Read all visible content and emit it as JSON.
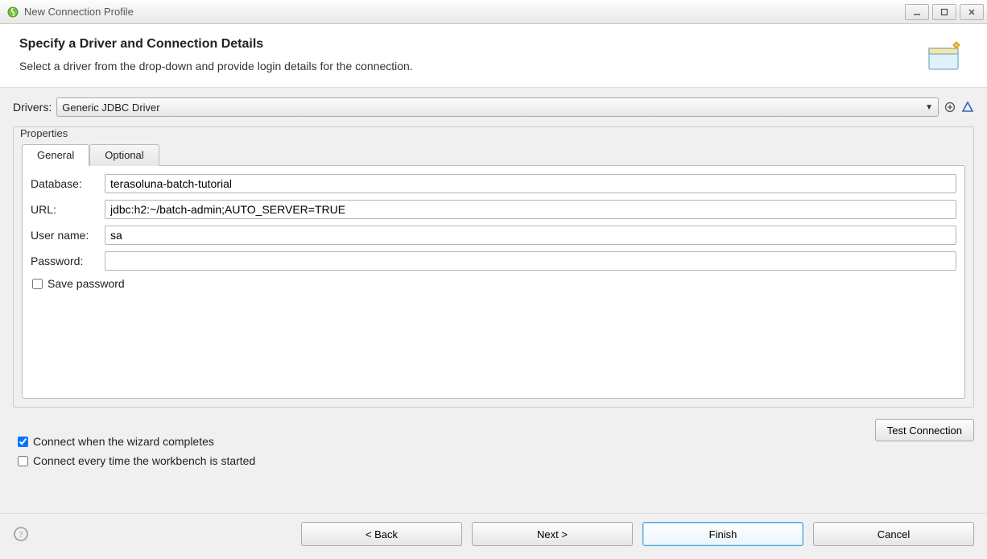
{
  "window": {
    "title": "New Connection Profile"
  },
  "header": {
    "title": "Specify a Driver and Connection Details",
    "subtitle": "Select a driver from the drop-down and provide login details for the connection."
  },
  "drivers": {
    "label": "Drivers:",
    "selected": "Generic JDBC Driver"
  },
  "properties": {
    "legend": "Properties",
    "tabs": {
      "general": "General",
      "optional": "Optional"
    },
    "general": {
      "database_label": "Database:",
      "database_value": "terasoluna-batch-tutorial",
      "url_label": "URL:",
      "url_value": "jdbc:h2:~/batch-admin;AUTO_SERVER=TRUE",
      "username_label": "User name:",
      "username_value": "sa",
      "password_label": "Password:",
      "password_value": "",
      "save_password_label": "Save password",
      "save_password_checked": false
    }
  },
  "options": {
    "connect_on_finish_label": "Connect when the wizard completes",
    "connect_on_finish_checked": true,
    "connect_on_start_label": "Connect every time the workbench is started",
    "connect_on_start_checked": false,
    "test_connection_label": "Test Connection"
  },
  "footer": {
    "back": "< Back",
    "next": "Next >",
    "finish": "Finish",
    "cancel": "Cancel"
  }
}
